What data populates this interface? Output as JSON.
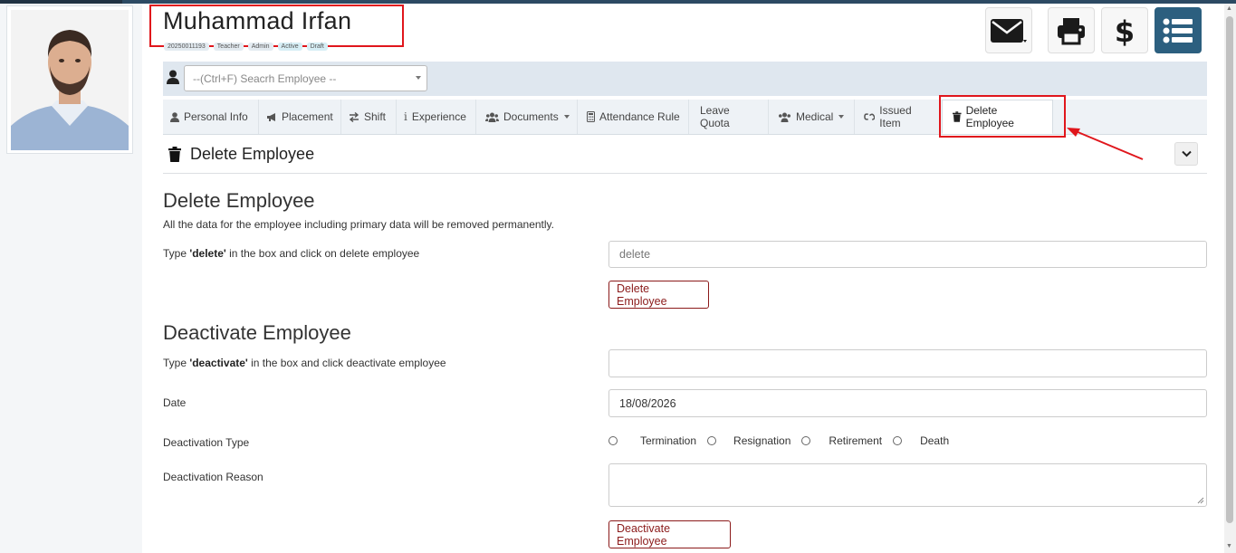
{
  "employee": {
    "name": "Muhammad Irfan",
    "badges": [
      "20250011193",
      "Teacher",
      "Admin",
      "Active",
      "Draft"
    ]
  },
  "header_buttons": [
    {
      "name": "email-button",
      "icon": "envelope-icon"
    },
    {
      "name": "print-button",
      "icon": "printer-icon"
    },
    {
      "name": "payment-button",
      "icon": "dollar-icon"
    },
    {
      "name": "menu-list-button",
      "icon": "list-icon"
    }
  ],
  "search": {
    "placeholder": "--(Ctrl+F) Seacrh Employee --"
  },
  "tabs": [
    {
      "label": "Personal Info",
      "icon": "user-icon"
    },
    {
      "label": "Placement",
      "icon": "bullhorn-icon"
    },
    {
      "label": "Shift",
      "icon": "exchange-icon"
    },
    {
      "label": "Experience",
      "icon": "info-icon"
    },
    {
      "label": "Documents",
      "icon": "users-icon"
    },
    {
      "label": "Attendance Rule",
      "icon": "calculator-icon"
    },
    {
      "label": "Leave Quota",
      "icon": ""
    },
    {
      "label": "Medical",
      "icon": "users-icon"
    },
    {
      "label": "Issued Item",
      "icon": "unlink-icon"
    },
    {
      "label": "Delete Employee",
      "icon": "trash-icon"
    }
  ],
  "section": {
    "title": "Delete Employee"
  },
  "delete": {
    "heading": "Delete Employee",
    "description": "All the data for the employee including primary data will be removed permanently.",
    "label_pre": "Type ",
    "label_key": "'delete'",
    "label_post": " in the box and click on delete employee",
    "input_placeholder": "delete",
    "button": "Delete Employee"
  },
  "deactivate": {
    "heading": "Deactivate Employee",
    "label_pre": "Type ",
    "label_key": "'deactivate'",
    "label_post": " in the box and click deactivate employee",
    "date_label": "Date",
    "date_value": "18/08/2026",
    "type_label": "Deactivation Type",
    "types": [
      "Termination",
      "Resignation",
      "Retirement",
      "Death"
    ],
    "reason_label": "Deactivation Reason",
    "button": "Deactivate Employee"
  },
  "colors": {
    "accent": "#2c5f7f",
    "highlight": "#e0161c",
    "danger_text": "#8b1a1a"
  }
}
